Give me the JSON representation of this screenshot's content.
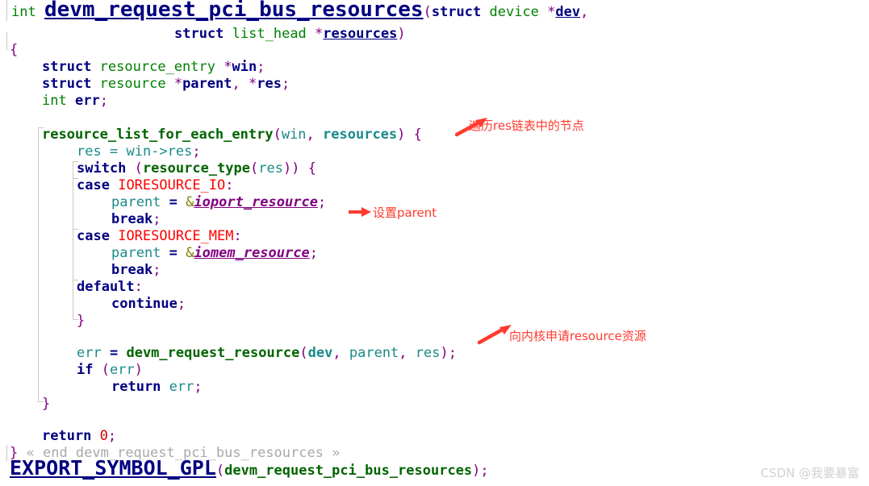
{
  "document": {
    "title": "devm_request_pci_bus_resources",
    "language": "C",
    "watermark": "CSDN @我要暴富"
  },
  "colors": {
    "keyword": "#000080",
    "type": "#008000",
    "function": "#006400",
    "macro": "#ff0000",
    "punctuation": "#800080",
    "global": "#800080",
    "plain_identifier": "#1a8a8a",
    "number": "#cc0000",
    "comment": "#a9a9a9",
    "annotation": "#ff3b30",
    "background": "#ffffff",
    "guide": "#c8c8c8",
    "watermark": "#d0d0d0"
  },
  "code": {
    "line_01": {
      "kw_int": "int",
      "name": "devm_request_pci_bus_resources",
      "paren_open": "(",
      "kw_struct": "struct",
      "type_device": "device",
      "star": "*",
      "param_dev": "dev",
      "comma": ","
    },
    "line_02": {
      "kw_struct": "struct",
      "type_list_head": "list_head",
      "star": "*",
      "param_resources": "resources",
      "paren_close": ")"
    },
    "line_03": {
      "brace_open": "{"
    },
    "line_04": {
      "kw_struct": "struct",
      "type": "resource_entry",
      "star": "*",
      "var": "win",
      "semi": ";"
    },
    "line_05": {
      "kw_struct": "struct",
      "type": "resource",
      "star1": "*",
      "var1": "parent",
      "comma": ",",
      "star2": "*",
      "var2": "res",
      "semi": ";"
    },
    "line_06": {
      "kw_int": "int",
      "var": "err",
      "semi": ";"
    },
    "line_07": {
      "macro": "resource_list_for_each_entry",
      "paren_open": "(",
      "arg1": "win",
      "comma": ",",
      "arg2": "resources",
      "paren_close": ")",
      "brace_open": "{"
    },
    "line_08": {
      "lhs": "res",
      "eq": "=",
      "rhs": "win->res",
      "semi": ";"
    },
    "line_09": {
      "kw_switch": "switch",
      "paren_open": "(",
      "fn": "resource_type",
      "fn_paren_open": "(",
      "arg": "res",
      "fn_paren_close": ")",
      "paren_close": ")",
      "brace_open": "{"
    },
    "line_10": {
      "kw_case": "case",
      "macro": "IORESOURCE_IO",
      "colon": ":"
    },
    "line_11": {
      "lhs": "parent",
      "eq": "=",
      "amp": "&",
      "global": "ioport_resource",
      "semi": ";"
    },
    "line_12": {
      "kw_break": "break",
      "semi": ";"
    },
    "line_13": {
      "kw_case": "case",
      "macro": "IORESOURCE_MEM",
      "colon": ":"
    },
    "line_14": {
      "lhs": "parent",
      "eq": "=",
      "amp": "&",
      "global": "iomem_resource",
      "semi": ";"
    },
    "line_15": {
      "kw_break": "break",
      "semi": ";"
    },
    "line_16": {
      "kw_default": "default",
      "colon": ":"
    },
    "line_17": {
      "kw_continue": "continue",
      "semi": ";"
    },
    "line_18": {
      "brace_close": "}"
    },
    "line_19": {
      "lhs": "err",
      "eq": "=",
      "fn": "devm_request_resource",
      "paren_open": "(",
      "arg1": "dev",
      "comma1": ",",
      "arg2": "parent",
      "comma2": ",",
      "arg3": "res",
      "paren_close": ")",
      "semi": ";"
    },
    "line_20": {
      "kw_if": "if",
      "paren_open": "(",
      "cond": "err",
      "paren_close": ")"
    },
    "line_21": {
      "kw_return": "return",
      "val": "err",
      "semi": ";"
    },
    "line_22": {
      "brace_close": "}"
    },
    "line_23": {
      "kw_return": "return",
      "val": "0",
      "semi": ";"
    },
    "line_24": {
      "brace_close": "}",
      "comment": "« end devm_request_pci_bus_resources »"
    },
    "line_25": {
      "macro": "EXPORT_SYMBOL_GPL",
      "paren_open": "(",
      "arg": "devm_request_pci_bus_resources",
      "paren_close": ")",
      "semi": ";"
    }
  },
  "annotations": [
    {
      "id": "annot-traverse",
      "text": "遍历res链表中的节点"
    },
    {
      "id": "annot-set-parent",
      "text": "设置parent"
    },
    {
      "id": "annot-request-resource",
      "text": "向内核申请resource资源"
    }
  ]
}
